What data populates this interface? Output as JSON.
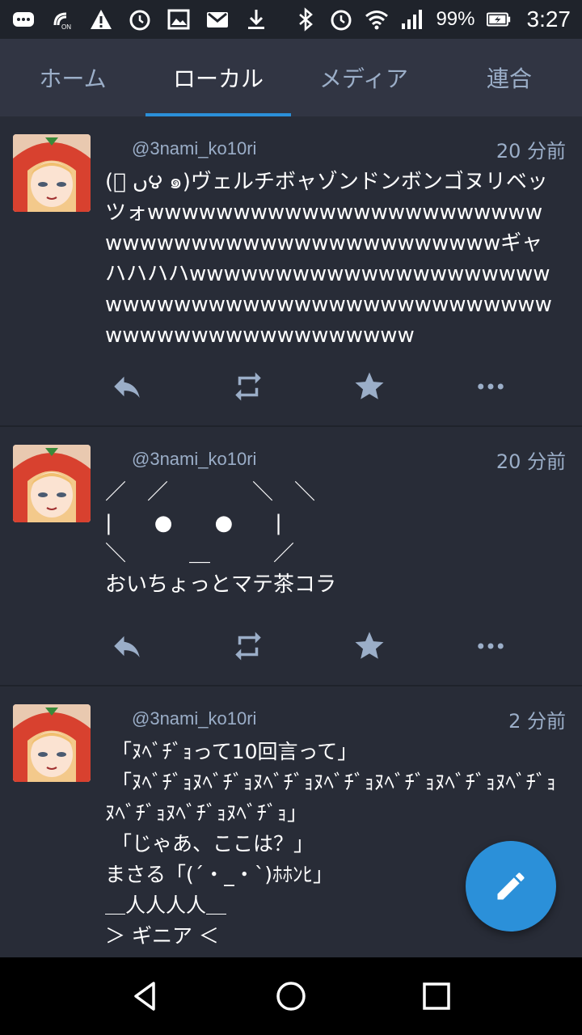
{
  "status_bar": {
    "battery_percent": "99%",
    "time": "3:27",
    "icons": [
      "message-icon",
      "nfc-icon",
      "warning-icon",
      "alarm-icon",
      "image-icon",
      "gmail-icon",
      "download-icon",
      "bluetooth-icon",
      "alarm-icon",
      "wifi-icon",
      "signal-icon",
      "battery-icon"
    ]
  },
  "tabs": [
    {
      "label": "ホーム",
      "active": false
    },
    {
      "label": "ローカル",
      "active": true
    },
    {
      "label": "メディア",
      "active": false
    },
    {
      "label": "連合",
      "active": false
    }
  ],
  "statuses": [
    {
      "account": "@3nami_ko10ri",
      "time": "20 分前",
      "content": "(ﾟ ں౪ ๑)ヴェルチボャゾンドンボンゴヌリベッツォwwwwwwwwwwwwwwwwwwwwwwwwwwwwwwwwwwwwwwwwwwwwwwギャハハハハwwwwwwwwwwwwwwwwwwwwwwwwwwwwwwwwwwwwwwwwwwwwwwwwwwwwwwwwwwwwwwwww"
    },
    {
      "account": "@3nami_ko10ri",
      "time": "20 分前",
      "content": "／　／　　　　＼　＼\n|　　●　　●　　|\n＼　　　＿　　　／\nおいちょっとマテ茶コラ"
    },
    {
      "account": "@3nami_ko10ri",
      "time": "2 分前",
      "content": " 「ﾇﾍﾞﾁﾞｮって10回言って」\n 「ﾇﾍﾞﾁﾞｮﾇﾍﾞﾁﾞｮﾇﾍﾞﾁﾞｮﾇﾍﾞﾁﾞｮﾇﾍﾞﾁﾞｮﾇﾍﾞﾁﾞｮﾇﾍﾞﾁﾞｮﾇﾍﾞﾁﾞｮﾇﾍﾞﾁﾞｮﾇﾍﾞﾁﾞｮ」\n 「じゃあ、ここは？」\nまさる「(´・_・`)ﾎﾎﾝﾋ」\n＿人人人人＿\n＞ ギニア ＜"
    }
  ],
  "colors": {
    "background": "#282c37",
    "tabbar": "#313543",
    "accent": "#2b90d9",
    "secondary_text": "#9baec8"
  }
}
